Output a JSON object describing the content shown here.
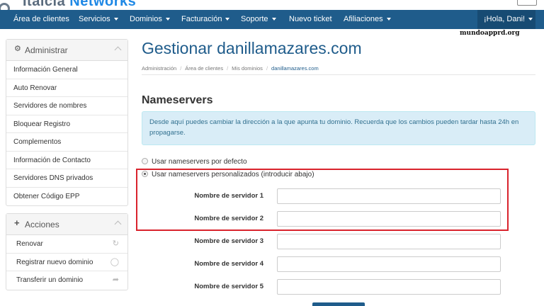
{
  "header": {
    "logo_part1": "Italcia",
    "logo_part2": "Networks"
  },
  "nav": {
    "items": [
      {
        "label": "Área de clientes",
        "dropdown": false
      },
      {
        "label": "Servicios",
        "dropdown": true
      },
      {
        "label": "Dominios",
        "dropdown": true
      },
      {
        "label": "Facturación",
        "dropdown": true
      },
      {
        "label": "Soporte",
        "dropdown": true
      },
      {
        "label": "Nuevo ticket",
        "dropdown": false
      },
      {
        "label": "Afiliaciones",
        "dropdown": true
      }
    ],
    "user_label": "¡Hola, Dani!"
  },
  "watermark": "mundoapprd.org",
  "sidebar": {
    "admin": {
      "title": "Administrar",
      "icon": "gear-icon",
      "items": [
        "Información General",
        "Auto Renovar",
        "Servidores de nombres",
        "Bloquear Registro",
        "Complementos",
        "Información de Contacto",
        "Servidores DNS privados",
        "Obtener Código EPP"
      ]
    },
    "actions": {
      "title": "Acciones",
      "icon": "plus-icon",
      "items": [
        {
          "label": "Renovar",
          "icon": "refresh-icon"
        },
        {
          "label": "Registrar nuevo dominio",
          "icon": "globe-icon"
        },
        {
          "label": "Transferir un dominio",
          "icon": "share-icon"
        }
      ]
    }
  },
  "main": {
    "title": "Gestionar danillamazares.com",
    "breadcrumb": [
      "Administración",
      "Área de clientes",
      "Mis dominios",
      "danillamazares.com"
    ],
    "section_title": "Nameservers",
    "info_text": "Desde aquí puedes cambiar la dirección a la que apunta tu dominio. Recuerda que los cambios pueden tardar hasta 24h en propagarse.",
    "options": [
      {
        "label": "Usar nameservers por defecto",
        "checked": false
      },
      {
        "label": "Usar nameservers personalizados (introducir abajo)",
        "checked": true
      }
    ],
    "nameservers": [
      {
        "label": "Nombre de servidor 1",
        "value": ""
      },
      {
        "label": "Nombre de servidor 2",
        "value": ""
      },
      {
        "label": "Nombre de servidor 3",
        "value": ""
      },
      {
        "label": "Nombre de servidor 4",
        "value": ""
      },
      {
        "label": "Nombre de servidor 5",
        "value": ""
      }
    ]
  },
  "colors": {
    "nav_bg": "#1f5c8b",
    "accent": "#1f5c8b",
    "info_bg": "#d9edf7",
    "highlight_border": "#d9232d"
  }
}
